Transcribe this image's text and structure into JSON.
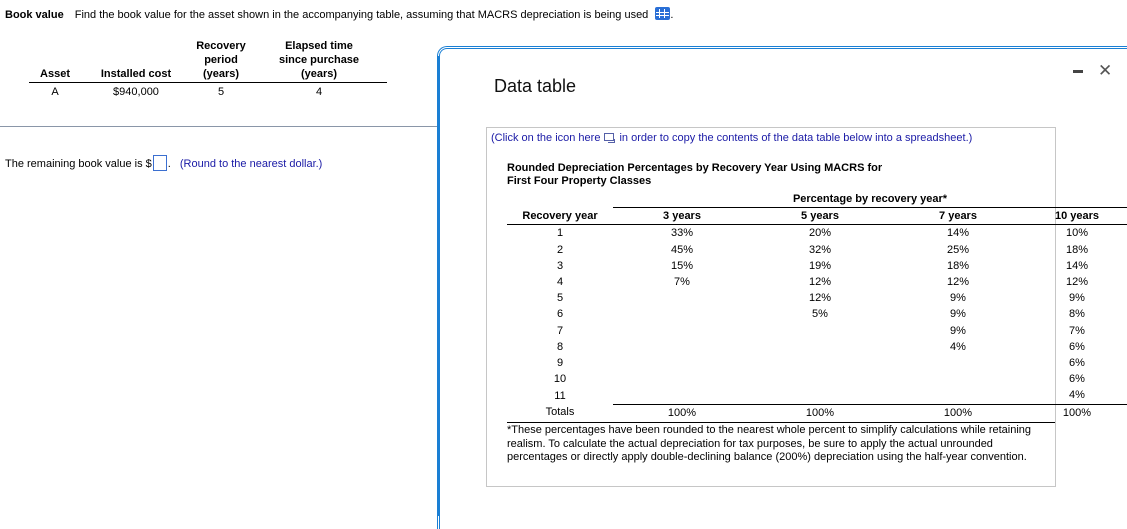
{
  "question": {
    "title": "Book value",
    "prompt": "Find the book value for the asset shown in the accompanying table, assuming that MACRS depreciation is being used",
    "trailing_period": ".",
    "table_icon": "spreadsheet-grid-icon"
  },
  "asset_table": {
    "headers": [
      "Asset",
      "Installed cost",
      "Recovery period (years)",
      "Elapsed time since purchase (years)"
    ],
    "header_lines": {
      "recovery": [
        "Recovery",
        "period",
        "(years)"
      ],
      "elapsed": [
        "Elapsed time",
        "since purchase",
        "(years)"
      ]
    },
    "rows": [
      {
        "asset": "A",
        "installed_cost": "$940,000",
        "recovery_period": "5",
        "elapsed_time": "4"
      }
    ]
  },
  "answer": {
    "prefix": "The remaining book value is $",
    "value": "",
    "suffix": ".",
    "hint": "(Round to the nearest dollar.)"
  },
  "popup": {
    "title": "Data table",
    "minimize_icon": "minimize-icon",
    "close_icon": "close-icon",
    "copy_note_before": "(Click on the icon here",
    "copy_note_after": "in order to copy the contents of the data table below into a spreadsheet.)",
    "table_title_line1": "Rounded Depreciation Percentages by Recovery Year Using MACRS for",
    "table_title_line2": "First Four Property Classes",
    "span_header": "Percentage by recovery year*",
    "col_headers": [
      "Recovery year",
      "3 years",
      "5 years",
      "7 years",
      "10 years"
    ],
    "rows": [
      [
        "1",
        "33%",
        "20%",
        "14%",
        "10%"
      ],
      [
        "2",
        "45%",
        "32%",
        "25%",
        "18%"
      ],
      [
        "3",
        "15%",
        "19%",
        "18%",
        "14%"
      ],
      [
        "4",
        "7%",
        "12%",
        "12%",
        "12%"
      ],
      [
        "5",
        "",
        "12%",
        "9%",
        "9%"
      ],
      [
        "6",
        "",
        "5%",
        "9%",
        "8%"
      ],
      [
        "7",
        "",
        "",
        "9%",
        "7%"
      ],
      [
        "8",
        "",
        "",
        "4%",
        "6%"
      ],
      [
        "9",
        "",
        "",
        "",
        "6%"
      ],
      [
        "10",
        "",
        "",
        "",
        "6%"
      ],
      [
        "11",
        "",
        "",
        "",
        "4%"
      ]
    ],
    "totals": [
      "Totals",
      "100%",
      "100%",
      "100%",
      "100%"
    ],
    "footnote": "*These percentages have been rounded to the nearest whole percent to simplify calculations while retaining realism. To calculate the actual depreciation for tax purposes, be sure to apply the actual unrounded percentages or directly apply double-declining balance (200%) depreciation using the half-year convention."
  },
  "colors": {
    "accent_blue": "#1a7fd4",
    "hint_text": "#1a1aa6",
    "grid_icon": "#2a6fd6"
  }
}
